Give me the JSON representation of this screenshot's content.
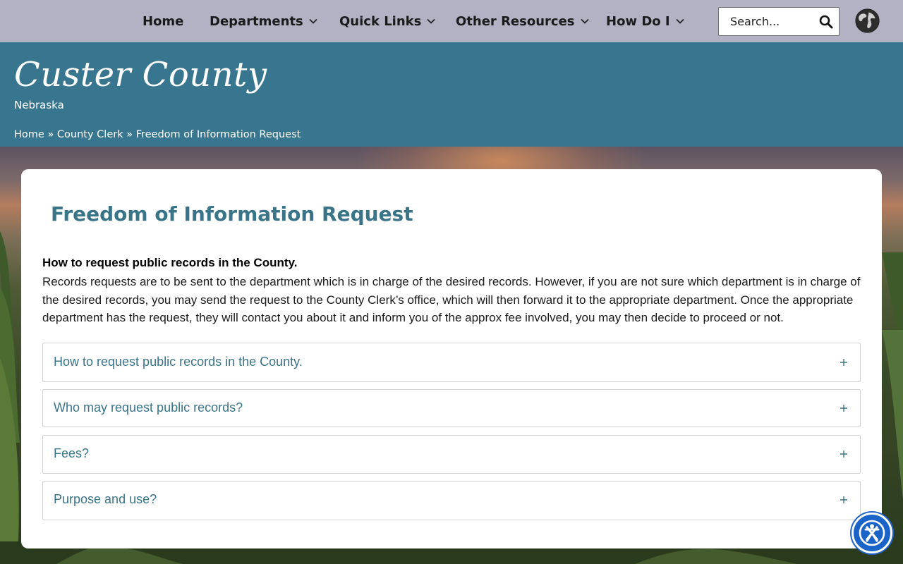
{
  "nav": {
    "items": [
      {
        "label": "Home",
        "has_dropdown": false
      },
      {
        "label": "Departments",
        "has_dropdown": true
      },
      {
        "label": "Quick Links",
        "has_dropdown": true
      },
      {
        "label": "Other Resources",
        "has_dropdown": true
      },
      {
        "label": "How Do I",
        "has_dropdown": true
      }
    ],
    "search": {
      "placeholder": "Search..."
    }
  },
  "header": {
    "site_title": "Custer County",
    "site_subtitle": "Nebraska",
    "breadcrumb": [
      {
        "label": "Home"
      },
      {
        "label": "County Clerk"
      },
      {
        "label": "Freedom of Information Request"
      }
    ],
    "separator": "»"
  },
  "main": {
    "title": "Freedom of Information Request",
    "intro_heading": "How to request public records in the County.",
    "intro_text": "Records requests are to be sent to the department which is in charge of the desired records. However, if you are not sure which department is in charge of the desired records, you may send the request to the County Clerk’s office, which will then forward it to the appropriate department. Once the appropriate department has the request, they will contact you about it and inform you of the approx fee involved, you may then decide to proceed or not.",
    "accordion": [
      {
        "label": "How to request public records in the County.",
        "expanded": false
      },
      {
        "label": "Who may request public records?",
        "expanded": false
      },
      {
        "label": "Fees?",
        "expanded": false
      },
      {
        "label": "Purpose and use?",
        "expanded": false
      }
    ]
  },
  "colors": {
    "nav_bg": "#b3b2c4",
    "header_bg": "#387690",
    "accent_text": "#3a7489",
    "accessibility_button": "#1a63c9"
  }
}
